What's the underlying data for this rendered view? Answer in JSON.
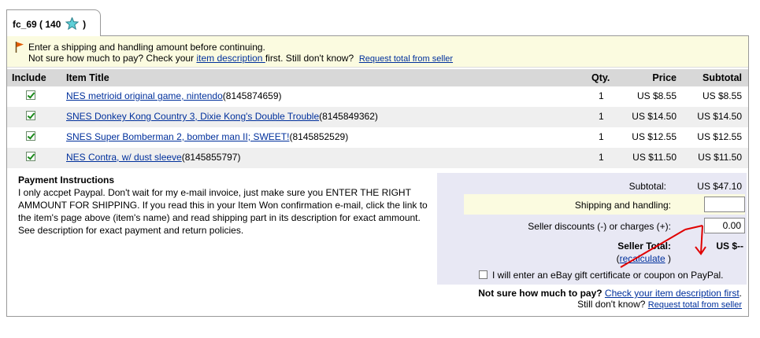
{
  "seller_tab": {
    "label_prefix": "fc_69 ( 140",
    "label_suffix": ")"
  },
  "notice": {
    "line1": "Enter a shipping and handling amount before continuing.",
    "line2_prefix": "Not sure how much to pay? Check your ",
    "line2_link": "item description ",
    "line2_suffix": "first. Still don't know?",
    "request_link": "Request total from seller"
  },
  "table": {
    "headers": {
      "include": "Include",
      "title": "Item Title",
      "qty": "Qty.",
      "price": "Price",
      "subtotal": "Subtotal"
    },
    "rows": [
      {
        "title": "NES metrioid original game, nintendo",
        "item_id": "(8145874659)",
        "qty": "1",
        "price": "US $8.55",
        "subtotal": "US $8.55"
      },
      {
        "title": "SNES Donkey Kong Country 3, Dixie Kong's Double Trouble",
        "item_id": "(8145849362)",
        "qty": "1",
        "price": "US $14.50",
        "subtotal": "US $14.50"
      },
      {
        "title": "SNES Super Bomberman 2, bomber man II; SWEET!",
        "item_id": "(8145852529)",
        "qty": "1",
        "price": "US $12.55",
        "subtotal": "US $12.55"
      },
      {
        "title": "NES Contra, w/ dust sleeve",
        "item_id": "(8145855797)",
        "qty": "1",
        "price": "US $11.50",
        "subtotal": "US $11.50"
      }
    ]
  },
  "payment": {
    "heading": "Payment Instructions",
    "text": "I only accpet Paypal. Don't wait for my e-mail invoice, just make sure you ENTER THE RIGHT AMMOUNT FOR SHIPPING. If you read this in your Item Won confirmation e-mail, click the link to the item's page above (item's name) and read shipping part in its description for exact ammount. See description for exact payment and return policies."
  },
  "totals": {
    "subtotal_label": "Subtotal:",
    "subtotal_value": "US $47.10",
    "shipping_label": "Shipping and handling:",
    "shipping_value": "",
    "discount_label": "Seller discounts (-) or charges (+):",
    "discount_value": "0.00",
    "seller_total_label": "Seller Total:",
    "seller_total_value": "US $--",
    "recalc_open": "(",
    "recalc_link": "recalculate",
    "recalc_close": ")",
    "gift_label": "I will enter an eBay gift certificate or coupon on PayPal."
  },
  "footer": {
    "q_bold": "Not sure how much to pay?",
    "q_link": "Check your item description first",
    "q_end": ".",
    "still": "Still don't know?",
    "request_link": "Request total from seller"
  },
  "colors": {
    "link": "#00309c",
    "notice_bg": "#fbfbe0",
    "header_bg": "#d8d8d8",
    "annotation_arrow": "#e00000"
  },
  "icons": {
    "tab": "star-icon",
    "notice": "flag-icon",
    "include": "checkbox-checked-icon"
  }
}
